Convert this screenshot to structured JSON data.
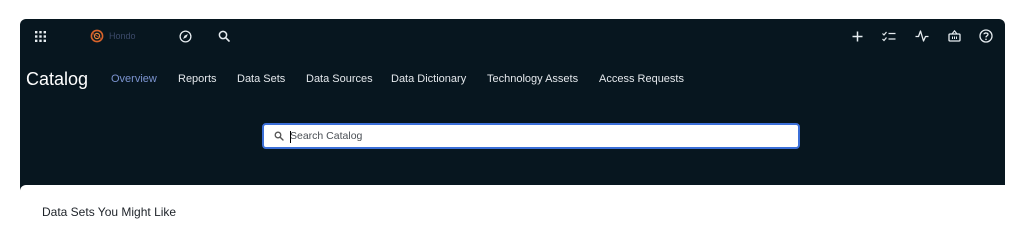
{
  "app": {
    "brand_name": "Hondo",
    "colors": {
      "background": "#07161f",
      "accent": "#7b93cf",
      "search_border": "#3b6fd8"
    }
  },
  "topbar": {
    "left_icons": [
      "apps-grid-icon",
      "compass-icon",
      "search-icon"
    ],
    "right_icons": [
      "plus-icon",
      "checklist-icon",
      "activity-icon",
      "basket-icon",
      "help-icon"
    ]
  },
  "page": {
    "title": "Catalog",
    "tabs": [
      {
        "label": "Overview",
        "active": true
      },
      {
        "label": "Reports"
      },
      {
        "label": "Data Sets"
      },
      {
        "label": "Data Sources"
      },
      {
        "label": "Data Dictionary"
      },
      {
        "label": "Technology Assets"
      },
      {
        "label": "Access Requests"
      }
    ]
  },
  "search": {
    "placeholder": "Search Catalog",
    "value": ""
  },
  "content": {
    "section_title": "Data Sets You Might Like"
  }
}
